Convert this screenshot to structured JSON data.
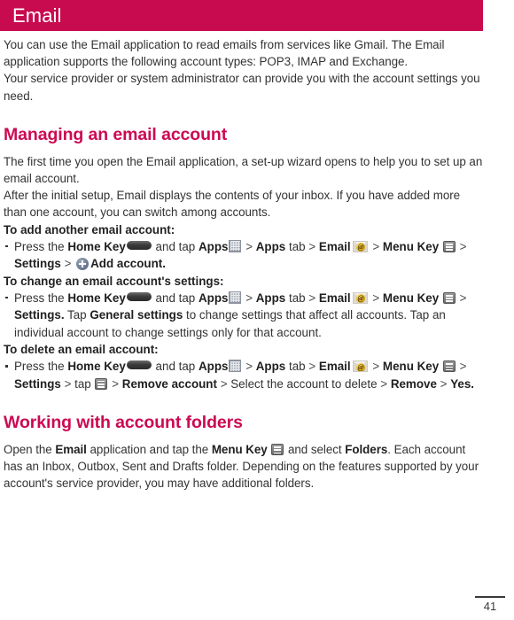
{
  "header": {
    "title": "Email",
    "bar_color": "#c80b4e"
  },
  "intro": {
    "paragraph_1": "You can use the Email application to read emails from services like Gmail. The Email application supports the following account types: POP3, IMAP and Exchange.",
    "paragraph_2": "Your service provider or system administrator can provide you with the account settings you need."
  },
  "sections": [
    {
      "heading": "Managing an email account",
      "heading_color": "#cc0a52",
      "paragraph_1": "The first time you open the Email application, a set-up wizard opens to help you to set up an email account.",
      "paragraph_2": "After the initial setup, Email displays the contents of your inbox. If you have added more than one account, you can switch among accounts."
    },
    {
      "heading": "Working with account folders",
      "heading_color": "#cc0a52"
    }
  ],
  "procedures": [
    {
      "lead_in": "To add another email account:",
      "step_parts": {
        "press_the": "Press the",
        "home_key": "Home Key",
        "and_tap": "and tap",
        "apps": "Apps",
        "apps_tab_bold": "Apps",
        "tab_word": "tab",
        "email": "Email",
        "menu_key": "Menu Key",
        "settings": "Settings",
        "add_account": "Add account.",
        "sep": ">"
      }
    },
    {
      "lead_in": "To change an email account's settings:",
      "step_parts": {
        "press_the": "Press the",
        "home_key": "Home Key",
        "and_tap": "and tap",
        "apps": "Apps",
        "apps_tab_bold": "Apps",
        "tab_word": "tab",
        "email": "Email",
        "menu_key": "Menu Key",
        "settings": "Settings.",
        "tap_word": "Tap",
        "general_settings": "General settings",
        "tail": "to change settings that affect all accounts. Tap an individual account to change settings only for that account.",
        "sep": ">"
      }
    },
    {
      "lead_in": "To delete an email account:",
      "step_parts": {
        "press_the": "Press the",
        "home_key": "Home Key",
        "and_tap": "and tap",
        "apps": "Apps",
        "apps_tab_bold": "Apps",
        "tab_word": "tab",
        "email": "Email",
        "menu_key": "Menu Key",
        "settings": "Settings",
        "tap_word": "tap",
        "remove_account": "Remove account",
        "select_account": "Select the account to delete",
        "remove": "Remove",
        "yes": "Yes.",
        "sep": ">"
      }
    }
  ],
  "folders_section": {
    "text_1": "Open the",
    "email_bold": "Email",
    "text_2": "application and tap the",
    "menu_key_bold": "Menu Key",
    "text_3": "and select",
    "folders_bold": "Folders",
    "text_4": ". Each account has an Inbox, Outbox, Sent and Drafts folder. Depending on the features supported by your account's service provider, you may have additional folders."
  },
  "icons": {
    "home_key": "home-key-icon",
    "menu_key": "menu-key-icon",
    "apps": "apps-grid-icon",
    "email": "email-envelope-at-icon",
    "add_account": "plus-circle-icon"
  },
  "footer": {
    "page_number": "41"
  }
}
